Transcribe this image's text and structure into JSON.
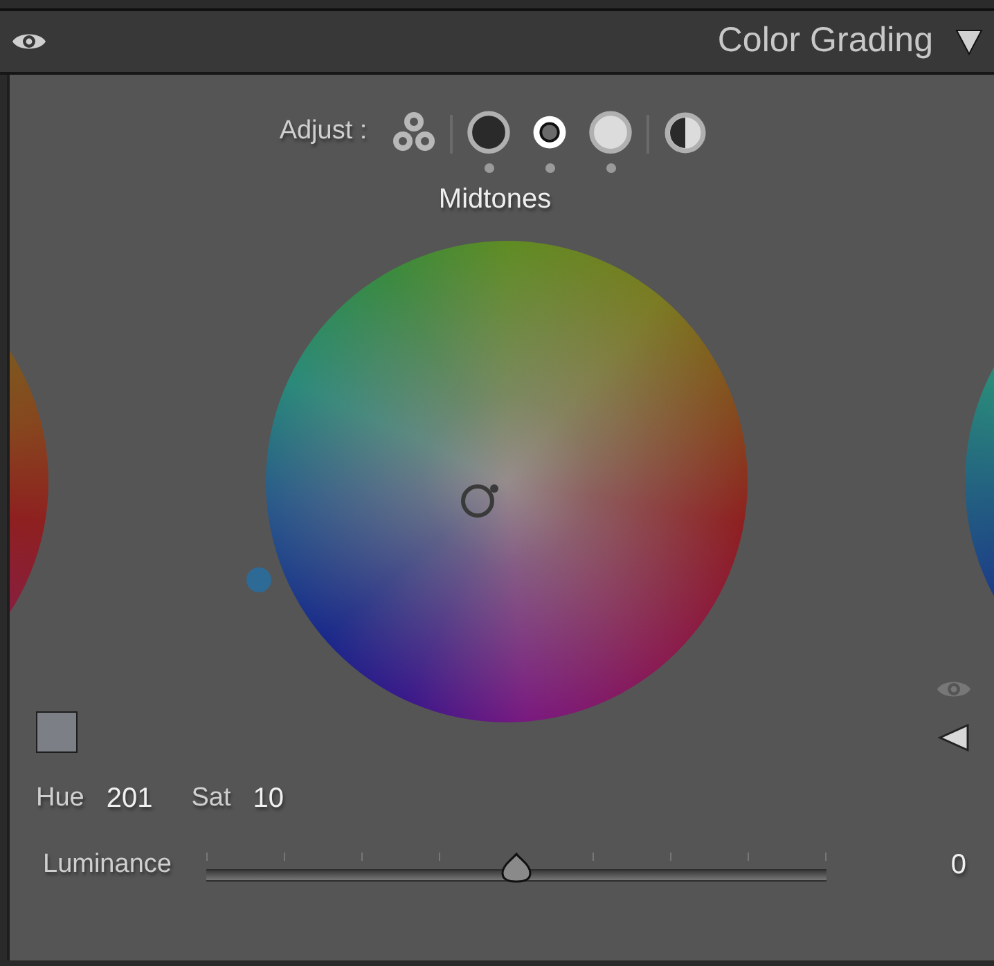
{
  "header": {
    "title": "Color Grading",
    "visible": true,
    "expanded": true
  },
  "adjust": {
    "label": "Adjust :",
    "modes": [
      {
        "kind": "three-way",
        "selected": false
      },
      {
        "kind": "shadows",
        "selected": false
      },
      {
        "kind": "midtones",
        "selected": true
      },
      {
        "kind": "highlights",
        "selected": false
      },
      {
        "kind": "global",
        "selected": false
      }
    ]
  },
  "mode_title": "Midtones",
  "hue": {
    "label": "Hue",
    "value": "201"
  },
  "sat": {
    "label": "Sat",
    "value": "10"
  },
  "luminance": {
    "label": "Luminance",
    "level": 0.5,
    "reading": "0"
  }
}
